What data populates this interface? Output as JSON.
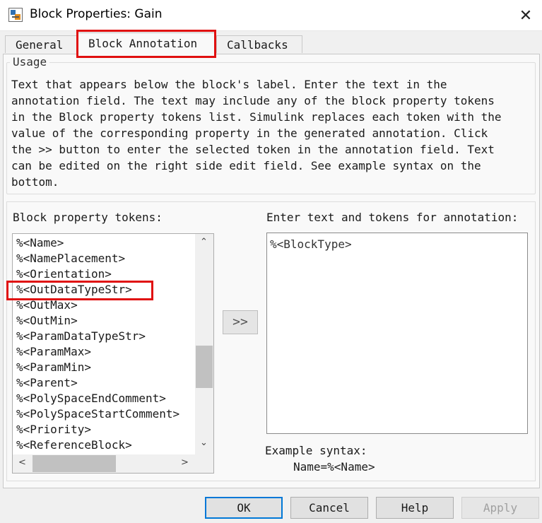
{
  "window": {
    "title": "Block Properties: Gain",
    "close_glyph": "✕"
  },
  "tabs": [
    {
      "label": "General"
    },
    {
      "label": "Block Annotation",
      "active": true
    },
    {
      "label": "Callbacks"
    }
  ],
  "usage": {
    "legend": "Usage",
    "text": "Text that appears below the block's label. Enter the text in the\nannotation field. The text may include any of the block property tokens\nin the Block property tokens list. Simulink replaces each token with the\nvalue of the corresponding property in the generated annotation. Click\nthe >> button to enter the selected token in the annotation field. Text\ncan be edited on the right side edit field. See example syntax on the\nbottom."
  },
  "tokens": {
    "label": "Block property tokens:",
    "items": [
      "%<Name>",
      "%<NamePlacement>",
      "%<Orientation>",
      "%<OutDataTypeStr>",
      "%<OutMax>",
      "%<OutMin>",
      "%<ParamDataTypeStr>",
      "%<ParamMax>",
      "%<ParamMin>",
      "%<Parent>",
      "%<PolySpaceEndComment>",
      "%<PolySpaceStartComment>",
      "%<Priority>",
      "%<ReferenceBlock>"
    ],
    "selected_index": 3,
    "scroll": {
      "up": "⌃",
      "down": "⌄",
      "left": "<",
      "right": ">"
    }
  },
  "move_button": {
    "label": ">>"
  },
  "annotation": {
    "label": "Enter text and tokens for annotation:",
    "value": "%<BlockType>"
  },
  "example": {
    "label": "Example syntax:",
    "value": "Name=%<Name>"
  },
  "buttons": {
    "ok": "OK",
    "cancel": "Cancel",
    "help": "Help",
    "apply": "Apply"
  },
  "colors": {
    "highlight": "#e01010",
    "default_button_border": "#0078d7"
  },
  "icons": {
    "app": "simulink-block-icon",
    "close": "close-icon"
  }
}
